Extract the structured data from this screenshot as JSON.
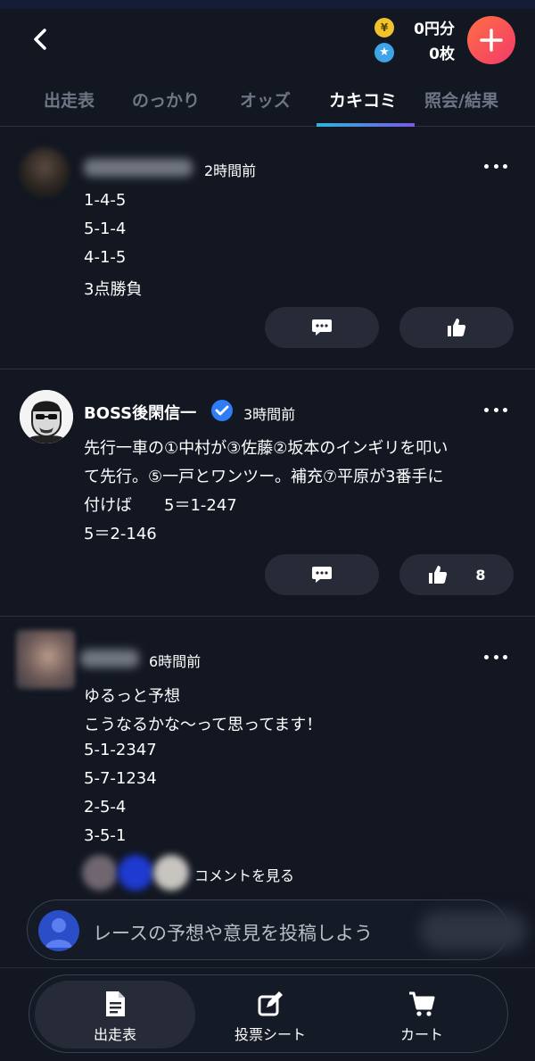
{
  "header": {
    "coins_value": "0円分",
    "tickets_value": "0枚"
  },
  "tabs": [
    {
      "label": "出走表"
    },
    {
      "label": "のっかり"
    },
    {
      "label": "オッズ"
    },
    {
      "label": "カキコミ"
    },
    {
      "label": "照会/結果"
    }
  ],
  "active_tab": "カキコミ",
  "posts": [
    {
      "author": "",
      "time": "2時間前",
      "lines": [
        "1-4-5",
        "5-1-4",
        "4-1-5",
        "3点勝負"
      ],
      "like_count": ""
    },
    {
      "author": "BOSS後閑信一",
      "verified": true,
      "time": "3時間前",
      "lines": [
        "先行一車の①中村が③佐藤②坂本のインギリを叩い",
        "て先行。⑤一戸とワンツー。補充⑦平原が3番手に",
        "付けば　　5＝1-247",
        "5＝2-146"
      ],
      "like_count": "8"
    },
    {
      "author": "",
      "time": "6時間前",
      "lines": [
        "ゆるっと予想",
        "こうなるかな〜って思ってます！",
        "5-1-2347",
        "5-7-1234",
        "2-5-4",
        "3-5-1"
      ],
      "see_comments": "コメントを見る"
    }
  ],
  "compose": {
    "placeholder": "レースの予想や意見を投稿しよう"
  },
  "bottom_nav": [
    {
      "label": "出走表",
      "icon": "document-icon",
      "active": true
    },
    {
      "label": "投票シート",
      "icon": "edit-icon"
    },
    {
      "label": "カート",
      "icon": "cart-icon"
    }
  ],
  "colors": {
    "background": "#121722",
    "accent_gradient_start": "#2bb7d8",
    "accent_gradient_end": "#7b57e8",
    "plus_button": "#f24a5a",
    "verified": "#2f7cf6"
  }
}
